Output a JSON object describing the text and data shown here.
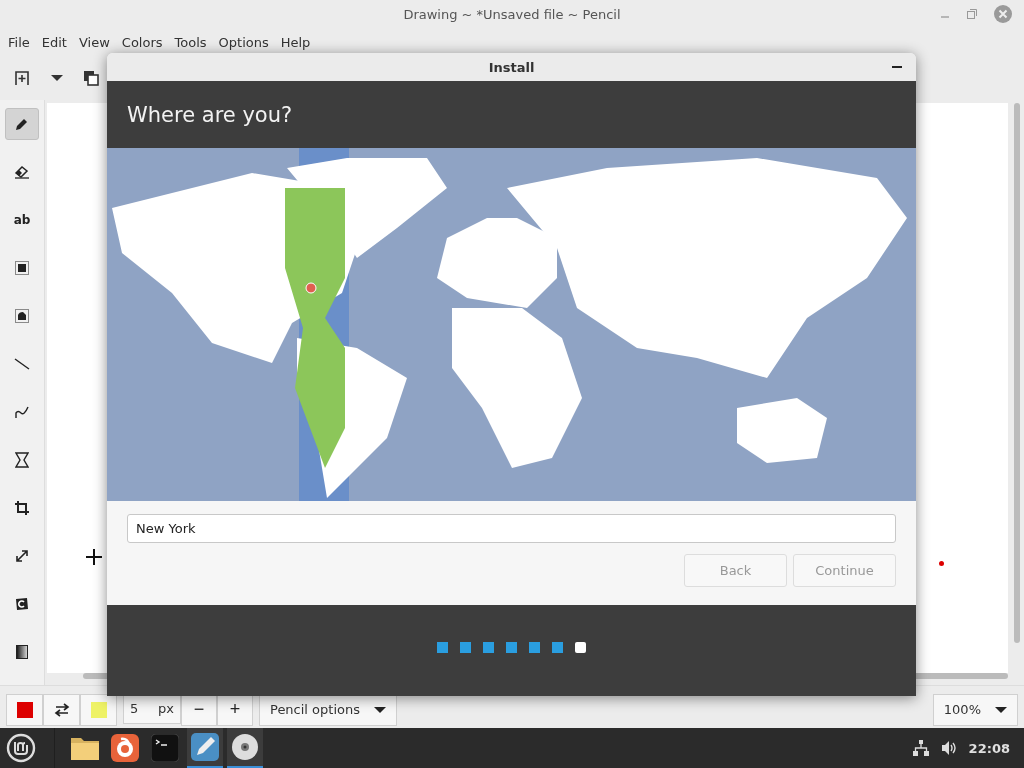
{
  "window": {
    "title": "Drawing ~ *Unsaved file ~ Pencil"
  },
  "menu": [
    "File",
    "Edit",
    "View",
    "Colors",
    "Tools",
    "Options",
    "Help"
  ],
  "tools": [
    {
      "kind": "pencil",
      "selected": true
    },
    {
      "kind": "eraser",
      "selected": false
    },
    {
      "kind": "text",
      "label": "ab",
      "selected": false
    },
    {
      "kind": "rect_select",
      "selected": false
    },
    {
      "kind": "free_select",
      "selected": false
    },
    {
      "kind": "line",
      "selected": false
    },
    {
      "kind": "curve",
      "selected": false
    },
    {
      "kind": "shape",
      "selected": false
    },
    {
      "kind": "crop",
      "selected": false
    },
    {
      "kind": "scale",
      "selected": false
    },
    {
      "kind": "rotate",
      "selected": false
    },
    {
      "kind": "filters",
      "selected": false
    }
  ],
  "colors": [
    {
      "color": "#dd0000"
    },
    {
      "color": "#eef266"
    }
  ],
  "bottom_bar": {
    "size": "5",
    "unit": "px",
    "minus": "−",
    "plus": "+",
    "options": "Pencil options",
    "zoom": "100%"
  },
  "installer": {
    "title": "Install",
    "heading": "Where are you?",
    "location": {
      "value": "New York"
    },
    "buttons": [
      {
        "label": "Back",
        "disabled": true
      },
      {
        "label": "Continue",
        "disabled": true
      }
    ],
    "steps": [
      {
        "current": false
      },
      {
        "current": false
      },
      {
        "current": false
      },
      {
        "current": false
      },
      {
        "current": false
      },
      {
        "current": false
      },
      {
        "current": true
      }
    ]
  },
  "taskbar": {
    "apps": [
      {
        "kind": "folder",
        "active": false
      },
      {
        "kind": "browser",
        "active": false
      },
      {
        "kind": "terminal",
        "active": false
      },
      {
        "kind": "editor",
        "active": true
      },
      {
        "kind": "disc",
        "active": true
      }
    ],
    "clock": "22:08"
  }
}
